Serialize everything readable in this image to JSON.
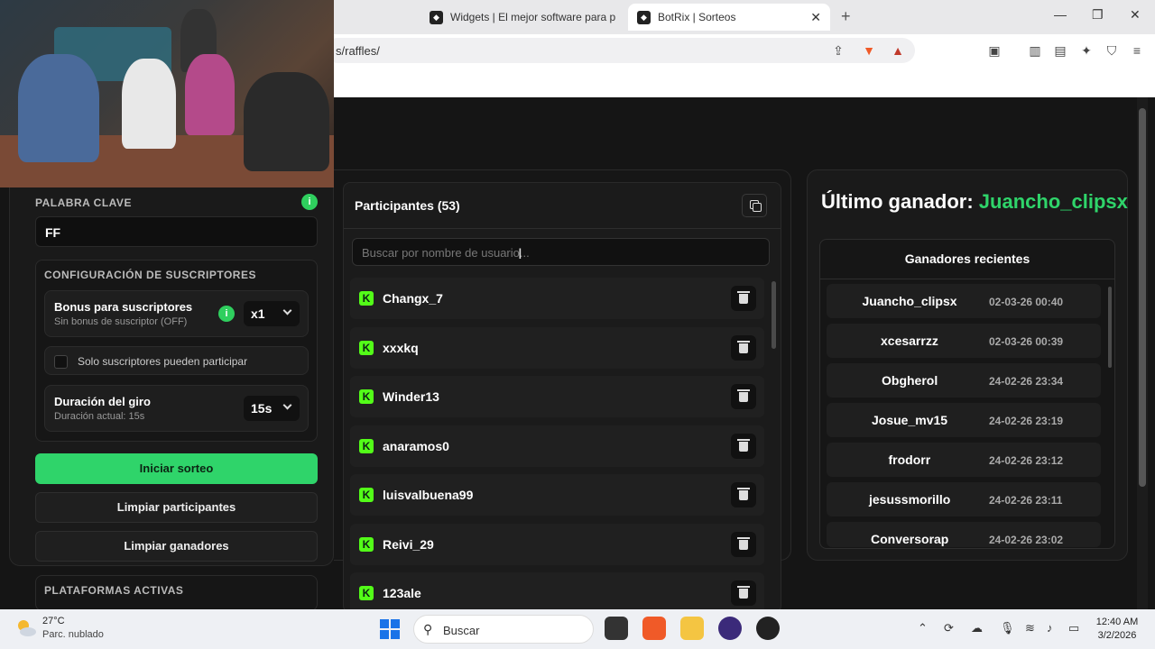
{
  "browser": {
    "tabs": [
      {
        "label": "Widgets | El mejor software para pot",
        "active": false
      },
      {
        "label": "BotRix | Sorteos",
        "active": true
      }
    ],
    "url": "s/raffles/"
  },
  "settings": {
    "keyword_label": "PALABRA CLAVE",
    "keyword_value": "FF",
    "subs_section_title": "CONFIGURACIÓN DE SUSCRIPTORES",
    "bonus_title": "Bonus para suscriptores",
    "bonus_sub": "Sin bonus de suscriptor (OFF)",
    "bonus_value": "x1",
    "only_subs_label": "Solo suscriptores pueden participar",
    "spin_title": "Duración del giro",
    "spin_sub": "Duración actual: 15s",
    "spin_value": "15s",
    "start_button": "Iniciar sorteo",
    "clear_participants_button": "Limpiar participantes",
    "clear_winners_button": "Limpiar ganadores",
    "platforms_label": "PLATAFORMAS ACTIVAS",
    "info_glyph": "i"
  },
  "participants": {
    "title": "Participantes (53)",
    "search_placeholder": "Buscar por nombre de usuario...",
    "list": [
      "Changx_7",
      "xxxkq",
      "Winder13",
      "anaramos0",
      "luisvalbuena99",
      "Reivi_29",
      "123ale"
    ],
    "platform_icon": "kick-icon"
  },
  "winners": {
    "last_label": "Último ganador:",
    "last_name": "Juancho_clipsx",
    "recent_title": "Ganadores recientes",
    "list": [
      {
        "name": "Juancho_clipsx",
        "date": "02-03-26 00:40"
      },
      {
        "name": "xcesarrzz",
        "date": "02-03-26 00:39"
      },
      {
        "name": "Obgherol",
        "date": "24-02-26 23:34"
      },
      {
        "name": "Josue_mv15",
        "date": "24-02-26 23:19"
      },
      {
        "name": "frodorr",
        "date": "24-02-26 23:12"
      },
      {
        "name": "jesussmorillo",
        "date": "24-02-26 23:11"
      },
      {
        "name": "Conversorap",
        "date": "24-02-26 23:02"
      }
    ]
  },
  "taskbar": {
    "temperature": "27°C",
    "weather": "Parc. nublado",
    "search": "Buscar",
    "time": "12:40 AM",
    "date": "3/2/2026"
  },
  "colors": {
    "accent": "#2fd46a",
    "kick": "#53fc18"
  }
}
